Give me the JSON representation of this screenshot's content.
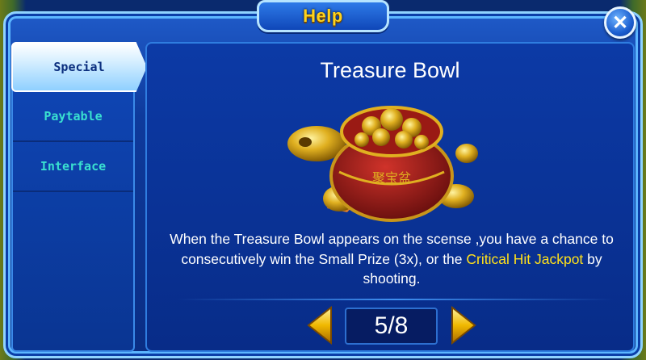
{
  "header": {
    "title": "Help"
  },
  "close": {
    "icon": "close-icon",
    "glyph": "✕"
  },
  "sidebar": {
    "items": [
      {
        "label": "Special",
        "active": true
      },
      {
        "label": "Paytable",
        "active": false
      },
      {
        "label": "Interface",
        "active": false
      }
    ]
  },
  "main": {
    "title": "Treasure Bowl",
    "description_part1": "When the Treasure Bowl appears on the scense ,you have a chance to consecutively win the Small Prize (3x), or the ",
    "description_highlight": "Critical Hit Jackpot",
    "description_part2": " by shooting.",
    "image": {
      "icon": "treasure-bowl-turtle-image",
      "bowl_inscription": "聚宝盆"
    }
  },
  "pagination": {
    "current": "5/8",
    "prev_icon": "arrow-left-icon",
    "next_icon": "arrow-right-icon"
  },
  "colors": {
    "accent_gold": "#ffd21a",
    "highlight": "#ffe01a",
    "nav_inactive": "#39e0d0",
    "panel_blue": "#0a2d84"
  }
}
